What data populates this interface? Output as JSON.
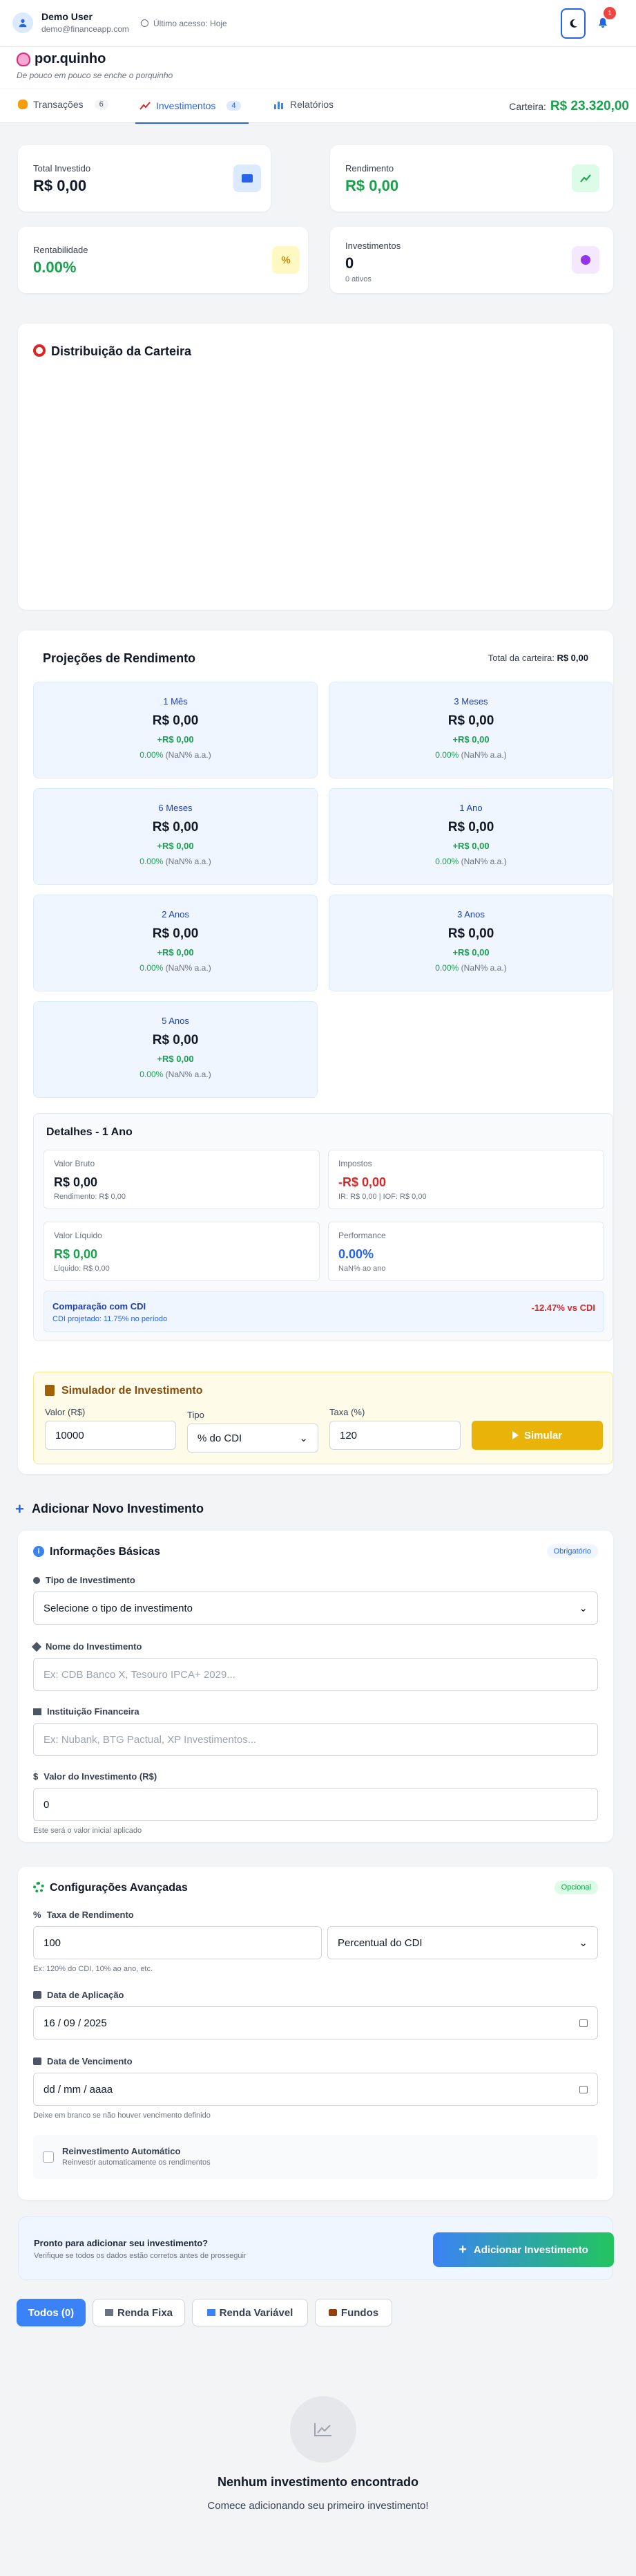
{
  "header": {
    "user_name": "Demo User",
    "user_email": "demo@financeapp.com",
    "last_access": "Último acesso: Hoje",
    "notif_count": "1"
  },
  "brand": {
    "name": "por.quinho",
    "tagline": "De pouco em pouco se enche o porquinho"
  },
  "tabs": [
    {
      "label": "Transações",
      "count": "6"
    },
    {
      "label": "Investimentos",
      "count": "4"
    },
    {
      "label": "Relatórios"
    }
  ],
  "wallet": {
    "label": "Carteira:",
    "value": "R$ 23.320,00"
  },
  "stats": [
    {
      "title": "Total Investido",
      "value": "R$ 0,00"
    },
    {
      "title": "Rendimento",
      "value": "R$ 0,00"
    },
    {
      "title": "Rentabilidade",
      "value": "0.00%"
    },
    {
      "title": "Investimentos",
      "value": "0",
      "sub": "0 ativos"
    }
  ],
  "distribution": {
    "title": "Distribuição da Carteira"
  },
  "projections": {
    "title": "Projeções de Rendimento",
    "total_label": "Total da carteira:",
    "total_value": "R$ 0,00",
    "items": [
      {
        "period": "1 Mês",
        "value": "R$ 0,00",
        "gain": "+R$ 0,00",
        "pct": "0.00%",
        "annual": "(NaN% a.a.)"
      },
      {
        "period": "3 Meses",
        "value": "R$ 0,00",
        "gain": "+R$ 0,00",
        "pct": "0.00%",
        "annual": "(NaN% a.a.)"
      },
      {
        "period": "6 Meses",
        "value": "R$ 0,00",
        "gain": "+R$ 0,00",
        "pct": "0.00%",
        "annual": "(NaN% a.a.)"
      },
      {
        "period": "1 Ano",
        "value": "R$ 0,00",
        "gain": "+R$ 0,00",
        "pct": "0.00%",
        "annual": "(NaN% a.a.)"
      },
      {
        "period": "2 Anos",
        "value": "R$ 0,00",
        "gain": "+R$ 0,00",
        "pct": "0.00%",
        "annual": "(NaN% a.a.)"
      },
      {
        "period": "3 Anos",
        "value": "R$ 0,00",
        "gain": "+R$ 0,00",
        "pct": "0.00%",
        "annual": "(NaN% a.a.)"
      },
      {
        "period": "5 Anos",
        "value": "R$ 0,00",
        "gain": "+R$ 0,00",
        "pct": "0.00%",
        "annual": "(NaN% a.a.)"
      }
    ]
  },
  "details": {
    "title": "Detalhes - 1 Ano",
    "gross": {
      "label": "Valor Bruto",
      "value": "R$ 0,00",
      "sub": "Rendimento: R$ 0,00"
    },
    "taxes": {
      "label": "Impostos",
      "value": "-R$ 0,00",
      "sub": "IR: R$ 0,00 | IOF: R$ 0,00"
    },
    "net": {
      "label": "Valor Líquido",
      "value": "R$ 0,00",
      "sub": "Líquido: R$ 0,00"
    },
    "performance": {
      "label": "Performance",
      "value": "0.00%",
      "sub": "NaN% ao ano"
    },
    "cdi": {
      "title": "Comparação com CDI",
      "sub": "CDI projetado: 11.75% no período",
      "diff": "-12.47% vs CDI"
    }
  },
  "simulator": {
    "title": "Simulador de Investimento",
    "value_label": "Valor (R$)",
    "value": "10000",
    "type_label": "Tipo",
    "type_value": "% do CDI",
    "rate_label": "Taxa (%)",
    "rate_value": "120",
    "button": "Simular"
  },
  "add_section": {
    "title": "Adicionar Novo Investimento"
  },
  "basic": {
    "title": "Informações Básicas",
    "badge": "Obrigatório",
    "type_label": "Tipo de Investimento",
    "type_value": "Selecione o tipo de investimento",
    "name_label": "Nome do Investimento",
    "name_placeholder": "Ex: CDB Banco X, Tesouro IPCA+ 2029...",
    "inst_label": "Instituição Financeira",
    "inst_placeholder": "Ex: Nubank, BTG Pactual, XP Investimentos...",
    "value_label": "Valor do Investimento (R$)",
    "value": "0",
    "value_hint": "Este será o valor inicial aplicado"
  },
  "advanced": {
    "title": "Configurações Avançadas",
    "badge": "Opcional",
    "rate_label": "Taxa de Rendimento",
    "rate_value": "100",
    "rate_type": "Percentual do CDI",
    "rate_hint": "Ex: 120% do CDI, 10% ao ano, etc.",
    "apply_label": "Data de Aplicação",
    "apply_value": "16 / 09 / 2025",
    "due_label": "Data de Vencimento",
    "due_value": "dd / mm / aaaa",
    "due_hint": "Deixe em branco se não houver vencimento definido",
    "reinvest_title": "Reinvestimento Automático",
    "reinvest_sub": "Reinvestir automaticamente os rendimentos"
  },
  "submit": {
    "title": "Pronto para adicionar seu investimento?",
    "sub": "Verifique se todos os dados estão corretos antes de prosseguir",
    "button": "Adicionar Investimento"
  },
  "filters": [
    {
      "label": "Todos (0)"
    },
    {
      "label": "Renda Fixa"
    },
    {
      "label": "Renda Variável"
    },
    {
      "label": "Fundos"
    }
  ],
  "empty": {
    "title": "Nenhum investimento encontrado",
    "sub": "Comece adicionando seu primeiro investimento!"
  },
  "colors": {
    "primary": "#2563eb",
    "green": "#16a34a",
    "red": "#dc2626",
    "yellow": "#eab308",
    "cta": "#22c55e"
  }
}
